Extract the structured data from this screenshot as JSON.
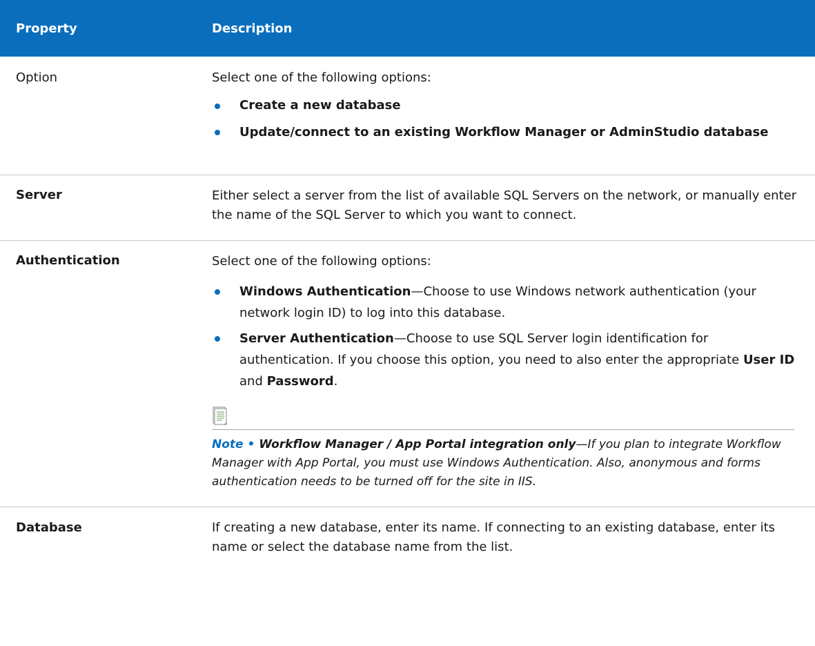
{
  "header": {
    "col_property": "Property",
    "col_description": "Description"
  },
  "rows": {
    "option": {
      "property": "Option",
      "intro": "Select one of the following options:",
      "items": [
        "Create a new database",
        "Update/connect to an existing Workflow Manager or AdminStudio database"
      ]
    },
    "server": {
      "property": "Server",
      "description": "Either select a server from the list of available SQL Servers on the network, or manually enter the name of the SQL Server to which you want to connect."
    },
    "authentication": {
      "property": "Authentication",
      "intro": "Select one of the following options:",
      "windows_term": "Windows Authentication",
      "windows_desc": "—Choose to use Windows network authentication (your network login ID) to log into this database.",
      "server_term": "Server Authentication",
      "server_desc_1": "—Choose to use SQL Server login identification for authentication. If you choose this option, you need to also enter the appropriate ",
      "user_id": "User ID",
      "and": " and ",
      "password": "Password",
      "period": ".",
      "note_label": "Note • ",
      "note_title": "Workflow Manager / App Portal integration only",
      "note_body": "—If you plan to integrate Workflow Manager with App Portal, you must use Windows Authentication. Also, anonymous and forms authentication needs to be turned off for the site in IIS.",
      "note_icon": "notepad-icon"
    },
    "database": {
      "property": "Database",
      "description": "If creating a new database, enter its name. If connecting to an existing database, enter its name or select the database name from the list."
    }
  },
  "colors": {
    "header_bg": "#0a6ebd",
    "accent": "#0a6ebd",
    "rule": "#c9c9c9"
  }
}
